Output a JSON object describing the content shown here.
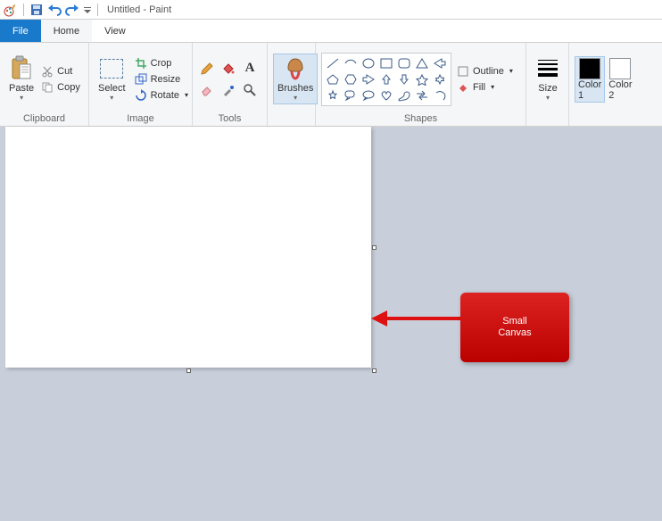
{
  "title": "Untitled - Paint",
  "tabs": {
    "file": "File",
    "home": "Home",
    "view": "View"
  },
  "clipboard": {
    "paste": "Paste",
    "cut": "Cut",
    "copy": "Copy",
    "label": "Clipboard"
  },
  "image": {
    "select": "Select",
    "crop": "Crop",
    "resize": "Resize",
    "rotate": "Rotate",
    "label": "Image"
  },
  "tools": {
    "label": "Tools"
  },
  "brushes": {
    "label": "Brushes"
  },
  "shapes": {
    "outline": "Outline",
    "fill": "Fill",
    "label": "Shapes"
  },
  "size": {
    "label": "Size"
  },
  "colors": {
    "c1": "Color\n1",
    "c2": "Color\n2"
  },
  "annotation": "Small\nCanvas"
}
